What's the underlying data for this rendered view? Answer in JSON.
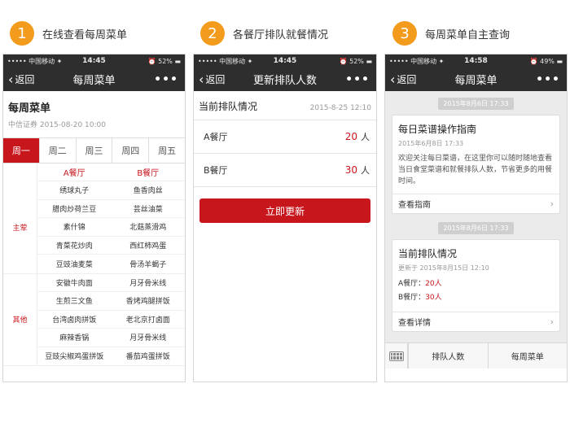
{
  "steps": [
    {
      "num": "1",
      "text": "在线查看每周菜单"
    },
    {
      "num": "2",
      "text": "各餐厅排队就餐情况"
    },
    {
      "num": "3",
      "text": "每周菜单自主查询"
    }
  ],
  "phone1": {
    "status": {
      "carrier": "••••• 中国移动 ✦",
      "time": "14:45",
      "battery": "⏰ 52% ▬"
    },
    "nav": {
      "back": "返回",
      "title": "每周菜单",
      "more": "•••"
    },
    "title": "每周菜单",
    "subtitle": "中信证券 2015-08-20 10:00",
    "tabs": [
      "周一",
      "周二",
      "周三",
      "周四",
      "周五"
    ],
    "active_tab": 0,
    "columns": [
      "A餐厅",
      "B餐厅"
    ],
    "sections": [
      {
        "category": "主荤",
        "rows": [
          [
            "绣球丸子",
            "鱼香肉丝"
          ],
          [
            "腊肉炒荷兰豆",
            "芸丝油菜"
          ],
          [
            "素什锦",
            "北菇蒸滑鸡"
          ],
          [
            "青菜花炒肉",
            "西红柿鸡蛋"
          ],
          [
            "豆豉油麦菜",
            "骨汤羊蝎子"
          ]
        ]
      },
      {
        "category": "其他",
        "rows": [
          [
            "安徽牛肉面",
            "月牙骨米线"
          ],
          [
            "生煎三文鱼",
            "香烤鸡腿拼饭"
          ],
          [
            "台湾卤肉拼饭",
            "老北京打卤面"
          ],
          [
            "麻辣香锅",
            "月牙骨米线"
          ],
          [
            "豆豉尖椒鸡蛋拼饭",
            "番茄鸡蛋拼饭"
          ]
        ]
      }
    ]
  },
  "phone2": {
    "status": {
      "carrier": "••••• 中国移动 ✦",
      "time": "14:45",
      "battery": "⏰ 52% ▬"
    },
    "nav": {
      "back": "返回",
      "title": "更新排队人数",
      "more": "•••"
    },
    "heading": "当前排队情况",
    "date": "2015-8-25 12:10",
    "rows": [
      {
        "name": "A餐厅",
        "value": "20",
        "unit": "人"
      },
      {
        "name": "B餐厅",
        "value": "30",
        "unit": "人"
      }
    ],
    "button": "立即更新"
  },
  "phone3": {
    "status": {
      "carrier": "••••• 中国移动 ✦",
      "time": "14:58",
      "battery": "⏰ 49% ▬"
    },
    "nav": {
      "back": "返回",
      "title": "每周菜单",
      "more": "•••"
    },
    "card1": {
      "stamp": "2015年8月6日  17:33",
      "title": "每日菜谱操作指南",
      "date": "2015年6月8日  17:33",
      "body": "欢迎关注每日菜谱，在这里你可以随时随地查看当日食堂菜谱和就餐排队人数，节省更多的用餐时间。",
      "link": "查看指南"
    },
    "card2": {
      "stamp": "2015年8月6日  17:33",
      "title": "当前排队情况",
      "date": "更新于 2015年8月15日  12:10",
      "a_label": "A餐厅：",
      "a_value": "20人",
      "b_label": "B餐厅：",
      "b_value": "30人",
      "link": "查看详情"
    },
    "bottom": {
      "btn1": "排队人数",
      "btn2": "每周菜单"
    }
  },
  "colors": {
    "accent": "#c8161d",
    "step": "#f29b1d",
    "bar": "#2e2e2e"
  }
}
